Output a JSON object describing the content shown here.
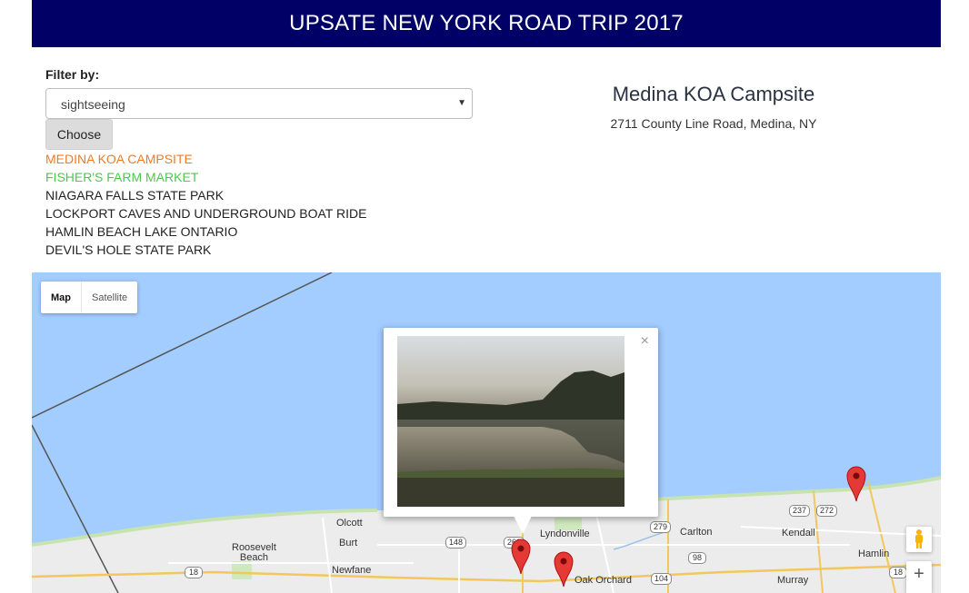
{
  "header": {
    "title": "UPSATE NEW YORK ROAD TRIP 2017"
  },
  "filter": {
    "label": "Filter by:",
    "selected": "sightseeing",
    "choose_label": "Choose"
  },
  "places": [
    {
      "name": "MEDINA KOA CAMPSITE",
      "color": "#f07b23"
    },
    {
      "name": "FISHER'S FARM MARKET",
      "color": "#4cc94c"
    },
    {
      "name": "NIAGARA FALLS STATE PARK",
      "color": "#222222"
    },
    {
      "name": "LOCKPORT CAVES AND UNDERGROUND BOAT RIDE",
      "color": "#222222"
    },
    {
      "name": "HAMLIN BEACH LAKE ONTARIO",
      "color": "#222222"
    },
    {
      "name": "DEVIL'S HOLE STATE PARK",
      "color": "#222222"
    }
  ],
  "detail": {
    "title": "Medina KOA Campsite",
    "address": "2711 County Line Road, Medina, NY"
  },
  "map": {
    "type_controls": {
      "map": "Map",
      "satellite": "Satellite"
    },
    "infowindow_close": "×",
    "zoom_in": "+",
    "town_labels": {
      "olcott": "Olcott",
      "burt": "Burt",
      "roosevelt_beach": "Roosevelt\nBeach",
      "newfane": "Newfane",
      "lyndonville": "Lyndonville",
      "carlton": "Carlton",
      "kendall": "Kendall",
      "hamlin": "Hamlin",
      "oak_orchard": "Oak Orchard",
      "murray": "Murray"
    },
    "route_shields": {
      "r148": "148",
      "r18a": "18",
      "r18b": "18",
      "r279": "279",
      "r98": "98",
      "r104": "104",
      "r237": "237",
      "r272": "272",
      "r260": "260"
    },
    "colors": {
      "water": "#a3ccff",
      "land": "#ececec",
      "marker": "#e53935"
    }
  }
}
